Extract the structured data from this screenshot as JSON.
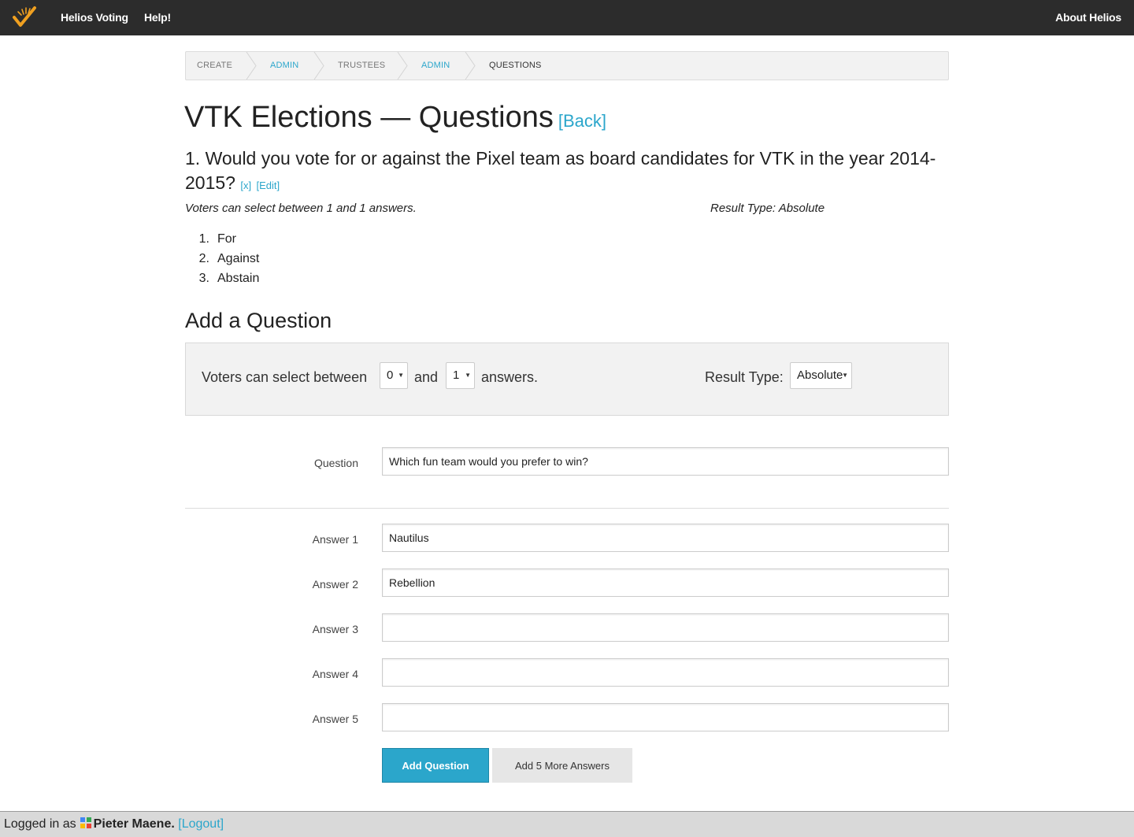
{
  "navbar": {
    "brand": "Helios Voting",
    "help": "Help!",
    "about": "About Helios",
    "logo_icon": "helios-checkmark-logo-icon"
  },
  "breadcrumbs": [
    {
      "label": "Create",
      "state": "inactive"
    },
    {
      "label": "Admin",
      "state": "link"
    },
    {
      "label": "Trustees",
      "state": "inactive"
    },
    {
      "label": "Admin",
      "state": "link"
    },
    {
      "label": "Questions",
      "state": "current"
    }
  ],
  "page": {
    "title": "VTK Elections — Questions",
    "back_link": "[Back]"
  },
  "existing_question": {
    "text": "1. Would you vote for or against the Pixel team as board candidates for VTK in the year 2014-2015?",
    "delete_link": "[x]",
    "edit_link": "[Edit]",
    "select_info": "Voters can select between 1 and 1 answers.",
    "result_type": "Result Type: Absolute",
    "answers": [
      {
        "num": "1.",
        "text": "For"
      },
      {
        "num": "2.",
        "text": "Against"
      },
      {
        "num": "3.",
        "text": "Abstain"
      }
    ]
  },
  "add_question": {
    "title": "Add a Question",
    "select_prefix": "Voters can select between",
    "and_text": "and",
    "answers_suffix": "answers.",
    "min_value": "0",
    "max_value": "1",
    "result_type_label": "Result Type:",
    "result_type_value": "Absolute",
    "question_label": "Question",
    "question_value": "Which fun team would you prefer to win?",
    "answers": [
      {
        "label": "Answer 1",
        "value": "Nautilus"
      },
      {
        "label": "Answer 2",
        "value": "Rebellion"
      },
      {
        "label": "Answer 3",
        "value": ""
      },
      {
        "label": "Answer 4",
        "value": ""
      },
      {
        "label": "Answer 5",
        "value": ""
      }
    ],
    "submit_label": "Add Question",
    "more_answers_label": "Add 5 More Answers"
  },
  "footer": {
    "logged_in_as": "Logged in as",
    "user_name": "Pieter Maene.",
    "logout_link": "[Logout]"
  },
  "colors": {
    "navbar_bg": "#2c2c2c",
    "accent": "#2ba6cb",
    "panel_bg": "#f2f2f2",
    "logo": "#f0a020"
  }
}
